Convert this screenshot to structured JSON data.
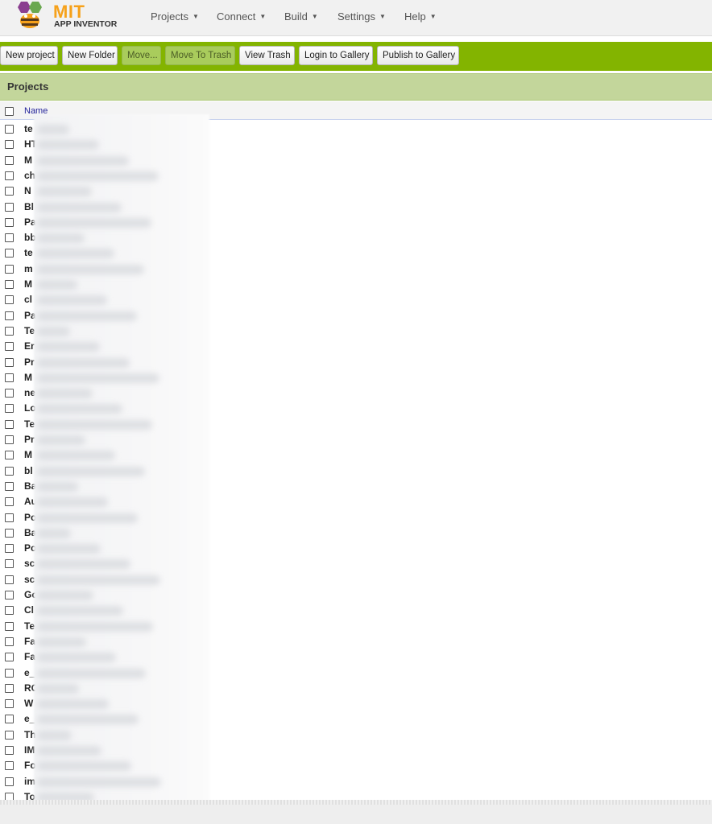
{
  "header": {
    "logo_title": "MIT",
    "logo_subtitle": "APP INVENTOR",
    "menus": [
      "Projects",
      "Connect",
      "Build",
      "Settings",
      "Help"
    ]
  },
  "toolbar": {
    "new_project": "New project",
    "new_folder": "New Folder",
    "move": "Move...",
    "move_to_trash": "Move To Trash",
    "view_trash": "View Trash",
    "login_gallery": "Login to Gallery",
    "publish_gallery": "Publish to Gallery"
  },
  "projects": {
    "title": "Projects",
    "column_name": "Name",
    "rows": [
      "te",
      "HT",
      "M",
      "ch",
      "N",
      "Bl",
      "Pa",
      "bb",
      "te",
      "m",
      "M",
      "cl",
      "Pa",
      "Te",
      "Er",
      "Pr",
      "M",
      "ne",
      "Lo",
      "Te",
      "Pr",
      "M",
      "bl",
      "Ba",
      "Au",
      "Po",
      "Ba",
      "Po",
      "sc",
      "sc",
      "Go",
      "Cl",
      "Te",
      "Fa",
      "Fa",
      "e_",
      "RC",
      "W",
      "e_",
      "Th",
      "IM",
      "Fo",
      "im",
      "To"
    ]
  },
  "colors": {
    "toolbar_green": "#83b400",
    "header_green": "#c3d69b",
    "logo_orange": "#f6a11a"
  }
}
